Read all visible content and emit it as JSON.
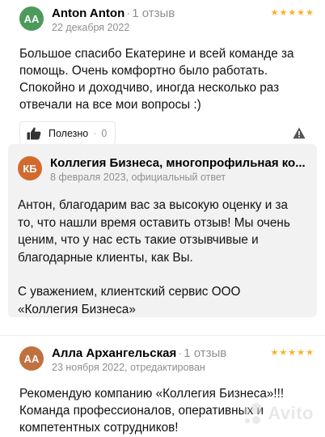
{
  "reviews": [
    {
      "avatar_initials": "AA",
      "avatar_color": "#4d9a5c",
      "author": "Anton Anton",
      "review_count": "1 отзыв",
      "date": "22 декабря 2022",
      "rating": 5,
      "text": "Большое спасибо Екатерине и всей команде за помощь. Очень комфортно было работать. Спокойно и доходчиво, иногда несколько раз отвечали на все мои вопросы :)",
      "helpful_label": "Полезно",
      "helpful_count": "0"
    },
    {
      "avatar_initials": "АА",
      "avatar_color": "#c0713e",
      "author": "Алла Архангельская",
      "review_count": "1 отзыв",
      "date": "23 ноября 2022, отредактирован",
      "rating": 5,
      "text": "Рекомендую компанию «Коллегия Бизнеса»!!! Команда профессионалов, оперативных и компетентных сотрудников!"
    }
  ],
  "reply": {
    "avatar_initials": "КБ",
    "avatar_color": "#d26a2e",
    "author": "Коллегия Бизнеса, многопрофильная ко...",
    "date": "8 февраля 2023, официальный ответ",
    "paragraph_1": "Антон, благодарим вас за высокую оценку и за то, что нашли время оставить отзыв! Мы очень ценим, что у нас есть такие отзывчивые и благодарные клиенты, как Вы.",
    "paragraph_2": "С уважением, клиентский сервис ООО «Коллегия Бизнеса»"
  },
  "colors": {
    "star": "#ffb021",
    "reply_background": "#f2f2f2",
    "muted_text": "#8f8f8f"
  },
  "icons": [
    "thumbs-up-icon",
    "report-warning-icon",
    "star-icon"
  ],
  "watermark": "Avito"
}
